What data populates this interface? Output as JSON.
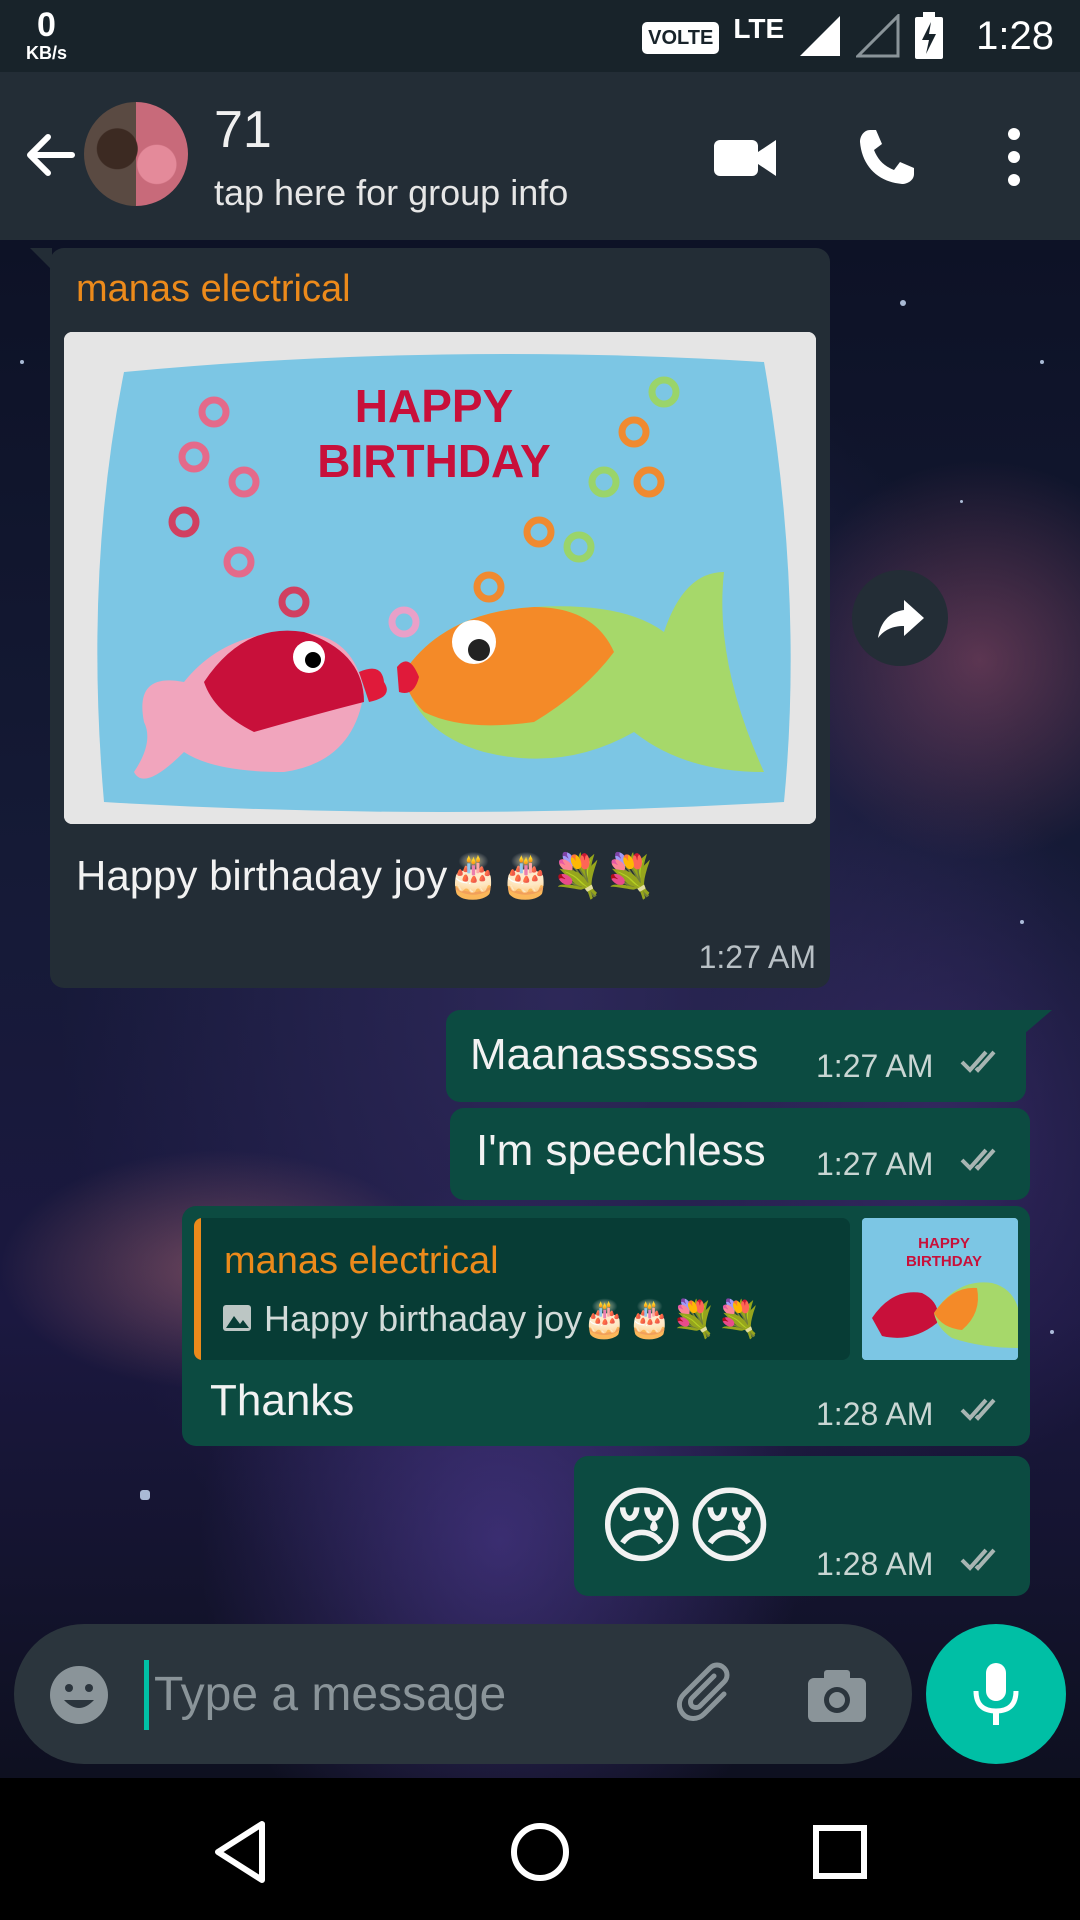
{
  "status_bar": {
    "data_rate": "0",
    "data_unit": "KB/s",
    "volte": "VOLTE",
    "network": "LTE",
    "time": "1:28"
  },
  "header": {
    "title": "71",
    "subtitle": "tap here for group info",
    "icons": [
      "back-arrow-icon",
      "video-call-icon",
      "phone-icon",
      "more-vertical-icon"
    ]
  },
  "messages": {
    "incoming": {
      "sender": "manas electrical",
      "image_text_line1": "HAPPY",
      "image_text_line2": "BIRTHDAY",
      "caption": "Happy birthaday joy🎂🎂💐💐",
      "time": "1:27 AM"
    },
    "out1": {
      "text": "Maanasssssss",
      "time": "1:27 AM"
    },
    "out2": {
      "text": "I'm speechless",
      "time": "1:27 AM"
    },
    "out3": {
      "quote_sender": "manas electrical",
      "quote_text": "Happy birthaday joy🎂🎂💐💐",
      "thumb_text_line1": "HAPPY",
      "thumb_text_line2": "BIRTHDAY",
      "text": "Thanks",
      "time": "1:28 AM"
    },
    "out4": {
      "text": "😢😢",
      "time": "1:28 AM"
    }
  },
  "input": {
    "placeholder": "Type a message"
  },
  "colors": {
    "header_bg": "#232d36",
    "outgoing_bubble": "#0c4b41",
    "incoming_bubble": "#232d36",
    "accent": "#00bfa5",
    "sender_name": "#ec8a1b",
    "read_ticks": "#a8b5b2"
  }
}
